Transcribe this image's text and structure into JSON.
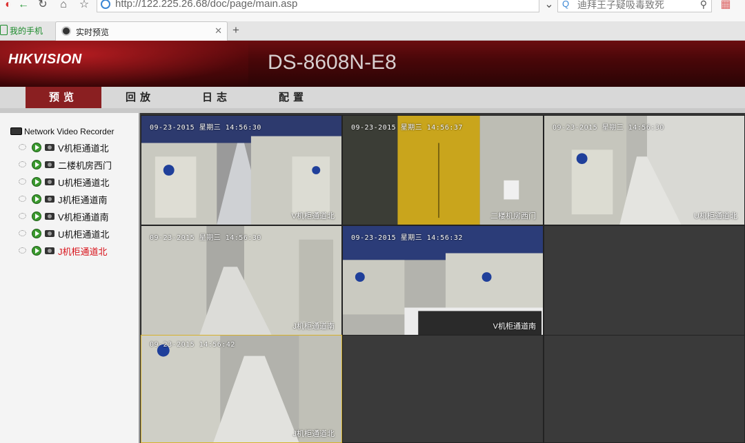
{
  "browser": {
    "url": "http://122.225.26.68/doc/page/main.asp",
    "search_placeholder": "迪拜王子疑吸毒致死",
    "bookmark_label": "我的手机",
    "tab_label": "实时预览"
  },
  "header": {
    "logo": "HIKVISION",
    "model": "DS-8608N-E8"
  },
  "menu": [
    {
      "label": "预览",
      "active": true
    },
    {
      "label": "回放",
      "active": false
    },
    {
      "label": "日志",
      "active": false
    },
    {
      "label": "配置",
      "active": false
    }
  ],
  "tree": {
    "root": "Network Video Recorder",
    "channels": [
      {
        "label": "V机柜通道北"
      },
      {
        "label": "二楼机房西门"
      },
      {
        "label": "U机柜通道北"
      },
      {
        "label": "J机柜通道南"
      },
      {
        "label": "V机柜通道南"
      },
      {
        "label": "U机柜通道北"
      },
      {
        "label": "J机柜通道北",
        "selected": true
      }
    ]
  },
  "video": {
    "cells": [
      {
        "timestamp": "09-23-2015 星期三 14:56:30",
        "name": "V机柜通道北"
      },
      {
        "timestamp": "09-23-2015 星期三 14:56:37",
        "name": "二楼机房西门"
      },
      {
        "timestamp": "09-23-2015 星期三 14:56:30",
        "name": "U机柜通道北"
      },
      {
        "timestamp": "09-23-2015 星期三 14:56:30",
        "name": "J机柜通道南"
      },
      {
        "timestamp": "09-23-2015 星期三 14:56:32",
        "name": "V机柜通道南"
      },
      {
        "timestamp": "",
        "name": ""
      },
      {
        "timestamp": "09-23-2015 14:56:42",
        "name": "J机柜通道北"
      },
      {
        "timestamp": "",
        "name": ""
      },
      {
        "timestamp": "",
        "name": ""
      }
    ]
  },
  "colors": {
    "header_dark": "#2b0405",
    "menu_active": "#8a1f21",
    "selected_channel": "#d8121a",
    "selected_cell_border": "#d6b12b"
  }
}
